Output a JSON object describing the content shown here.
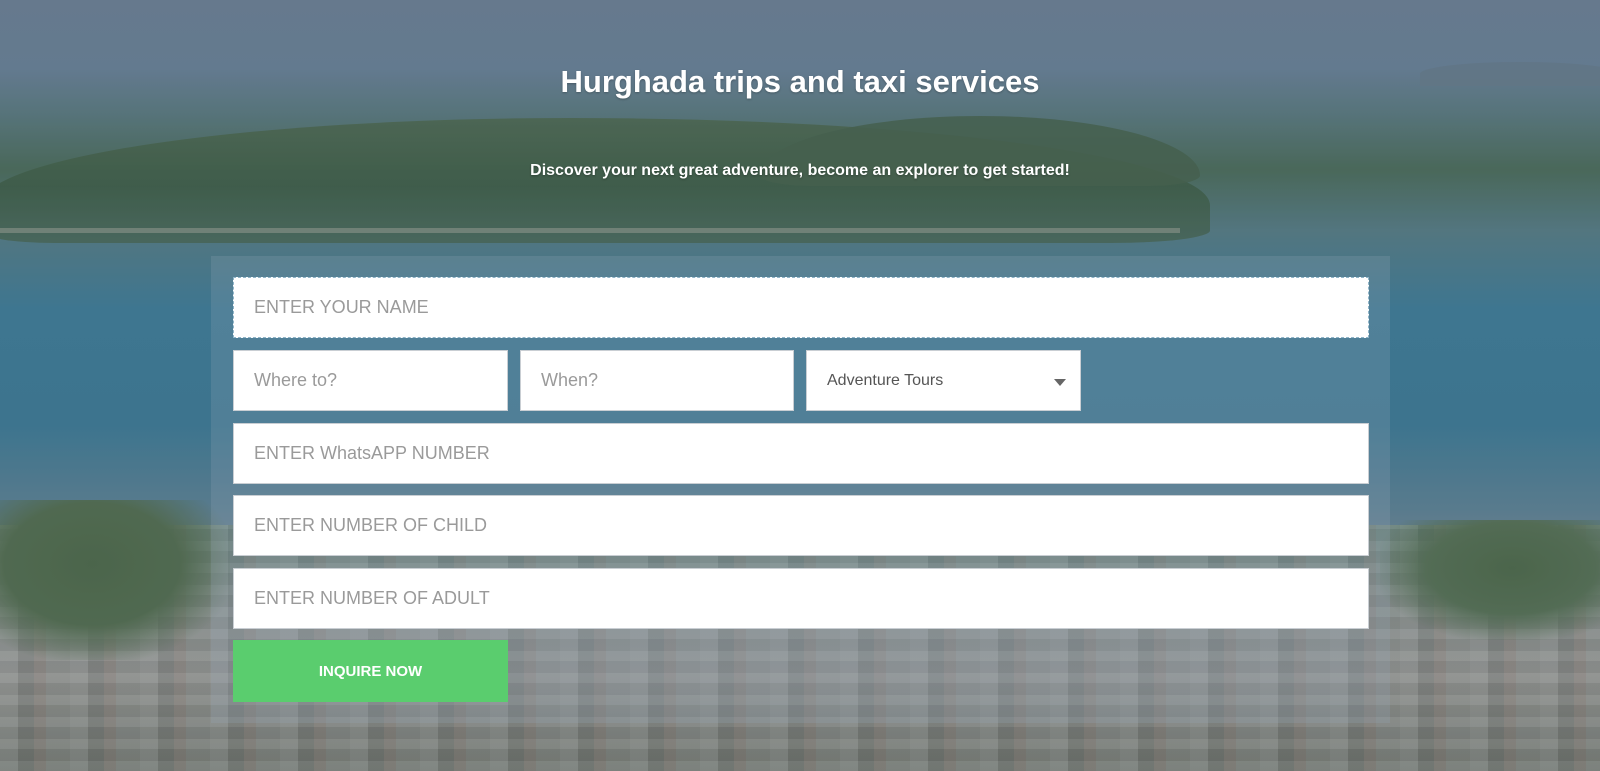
{
  "header": {
    "title": "Hurghada trips and taxi services",
    "subtitle": "Discover your next great adventure, become an explorer to get started!"
  },
  "form": {
    "name": {
      "placeholder": "ENTER YOUR NAME",
      "value": ""
    },
    "where": {
      "placeholder": "Where to?",
      "value": ""
    },
    "when": {
      "placeholder": "When?",
      "value": ""
    },
    "category": {
      "selected": "Adventure Tours"
    },
    "whatsapp": {
      "placeholder": "ENTER WhatsAPP NUMBER",
      "value": ""
    },
    "children": {
      "placeholder": "ENTER NUMBER OF CHILD",
      "value": ""
    },
    "adults": {
      "placeholder": "ENTER NUMBER OF ADULT",
      "value": ""
    },
    "submit_label": "INQUIRE NOW"
  },
  "colors": {
    "button": "#5acd6e",
    "title_text": "#ffffff"
  },
  "icons": {
    "select_caret": "caret-down-icon"
  }
}
